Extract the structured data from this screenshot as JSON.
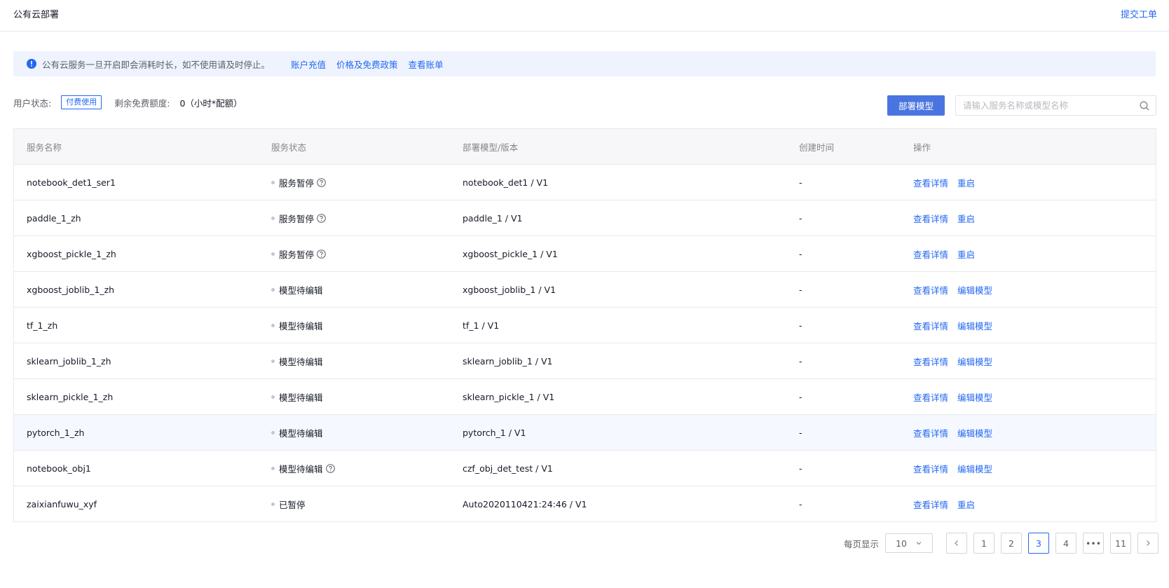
{
  "header": {
    "title": "公有云部署",
    "submit_ticket": "提交工单"
  },
  "notice": {
    "text": "公有云服务一旦开启即会消耗时长，如不使用请及时停止。",
    "links": [
      "账户充值",
      "价格及免费政策",
      "查看账单"
    ]
  },
  "status": {
    "user_label": "用户状态:",
    "badge": "付费使用",
    "quota_label": "剩余免费额度:",
    "quota_value": "0（小时*配额）"
  },
  "toolbar": {
    "deploy_label": "部署模型",
    "search_placeholder": "请输入服务名称或模型名称"
  },
  "table": {
    "headers": [
      "服务名称",
      "服务状态",
      "部署模型/版本",
      "创建时间",
      "操作"
    ],
    "rows": [
      {
        "name": "notebook_det1_ser1",
        "status": "服务暂停",
        "help": true,
        "model": "notebook_det1 / V1",
        "time": "-",
        "op1": "查看详情",
        "op2": "重启"
      },
      {
        "name": "paddle_1_zh",
        "status": "服务暂停",
        "help": true,
        "model": "paddle_1 / V1",
        "time": "-",
        "op1": "查看详情",
        "op2": "重启"
      },
      {
        "name": "xgboost_pickle_1_zh",
        "status": "服务暂停",
        "help": true,
        "model": "xgboost_pickle_1 / V1",
        "time": "-",
        "op1": "查看详情",
        "op2": "重启"
      },
      {
        "name": "xgboost_joblib_1_zh",
        "status": "模型待编辑",
        "help": false,
        "model": "xgboost_joblib_1 / V1",
        "time": "-",
        "op1": "查看详情",
        "op2": "编辑模型"
      },
      {
        "name": "tf_1_zh",
        "status": "模型待编辑",
        "help": false,
        "model": "tf_1 / V1",
        "time": "-",
        "op1": "查看详情",
        "op2": "编辑模型"
      },
      {
        "name": "sklearn_joblib_1_zh",
        "status": "模型待编辑",
        "help": false,
        "model": "sklearn_joblib_1 / V1",
        "time": "-",
        "op1": "查看详情",
        "op2": "编辑模型"
      },
      {
        "name": "sklearn_pickle_1_zh",
        "status": "模型待编辑",
        "help": false,
        "model": "sklearn_pickle_1 / V1",
        "time": "-",
        "op1": "查看详情",
        "op2": "编辑模型"
      },
      {
        "name": "pytorch_1_zh",
        "status": "模型待编辑",
        "help": false,
        "model": "pytorch_1 / V1",
        "time": "-",
        "op1": "查看详情",
        "op2": "编辑模型"
      },
      {
        "name": "notebook_obj1",
        "status": "模型待编辑",
        "help": true,
        "model": "czf_obj_det_test / V1",
        "time": "-",
        "op1": "查看详情",
        "op2": "编辑模型"
      },
      {
        "name": "zaixianfuwu_xyf",
        "status": "已暂停",
        "help": false,
        "model": "Auto2020110421:24:46 / V1",
        "time": "-",
        "op1": "查看详情",
        "op2": "重启"
      }
    ]
  },
  "pagination": {
    "per_page_label": "每页显示",
    "page_size": "10",
    "pages": [
      "1",
      "2",
      "3",
      "4",
      "•••",
      "11"
    ],
    "current": "3"
  },
  "colors": {
    "accent": "#2468f2",
    "button": "#4a74e0",
    "highlight_row": "#f5f9ff"
  }
}
